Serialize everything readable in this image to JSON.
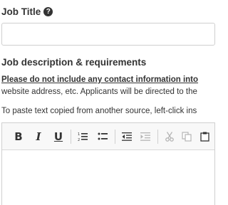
{
  "job_title": {
    "label": "Job Title",
    "help_icon": "question-circle-icon",
    "input_value": ""
  },
  "description": {
    "heading": "Job description & requirements",
    "notice_bold": "Please do not include any contact information into",
    "notice_rest": "website address, etc. Applicants will be directed to the",
    "paste_hint": "To paste text copied from another source, left-click ins"
  },
  "toolbar": {
    "buttons": [
      {
        "name": "bold",
        "glyph": "B",
        "disabled": false
      },
      {
        "name": "italic",
        "glyph": "I",
        "disabled": false
      },
      {
        "name": "underline",
        "glyph": "U",
        "disabled": false
      },
      {
        "name": "numbered-list",
        "icon": "numbered-list-icon",
        "disabled": false
      },
      {
        "name": "bulleted-list",
        "icon": "bulleted-list-icon",
        "disabled": false
      },
      {
        "name": "decrease-indent",
        "icon": "outdent-icon",
        "disabled": false
      },
      {
        "name": "increase-indent",
        "icon": "indent-icon",
        "disabled": true
      },
      {
        "name": "cut",
        "icon": "scissors-icon",
        "disabled": true
      },
      {
        "name": "copy",
        "icon": "copy-icon",
        "disabled": true
      },
      {
        "name": "paste",
        "icon": "paste-icon",
        "disabled": false
      }
    ]
  },
  "editor": {
    "content": ""
  },
  "colors": {
    "text": "#333333",
    "border": "#cfcfcf",
    "toolbar_bg": "#f8f8f8",
    "disabled": "#b5b5b5"
  }
}
